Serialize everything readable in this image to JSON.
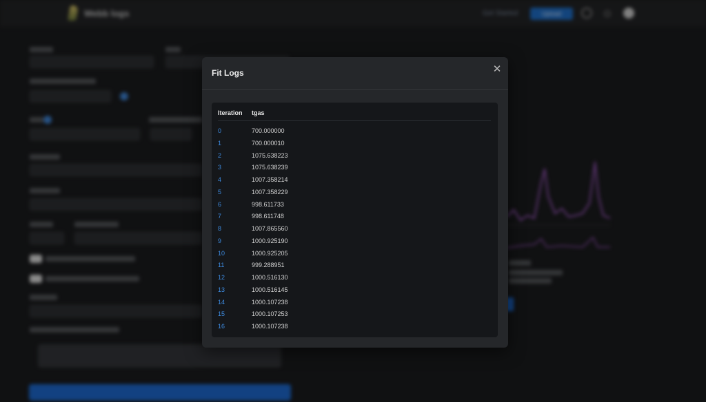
{
  "app": {
    "brand": "Webb logs",
    "nav_link": "Get Started",
    "nav_primary": "Upload"
  },
  "modal": {
    "title": "Fit Logs",
    "close_icon": "close-icon",
    "table": {
      "headers": {
        "iteration": "Iteration",
        "tgas": "tgas"
      },
      "rows": [
        {
          "iteration": "0",
          "tgas": "700.000000"
        },
        {
          "iteration": "1",
          "tgas": "700.000010"
        },
        {
          "iteration": "2",
          "tgas": "1075.638223"
        },
        {
          "iteration": "3",
          "tgas": "1075.638239"
        },
        {
          "iteration": "4",
          "tgas": "1007.358214"
        },
        {
          "iteration": "5",
          "tgas": "1007.358229"
        },
        {
          "iteration": "6",
          "tgas": "998.611733"
        },
        {
          "iteration": "7",
          "tgas": "998.611748"
        },
        {
          "iteration": "8",
          "tgas": "1007.865560"
        },
        {
          "iteration": "9",
          "tgas": "1000.925190"
        },
        {
          "iteration": "10",
          "tgas": "1000.925205"
        },
        {
          "iteration": "11",
          "tgas": "999.288951"
        },
        {
          "iteration": "12",
          "tgas": "1000.516130"
        },
        {
          "iteration": "13",
          "tgas": "1000.516145"
        },
        {
          "iteration": "14",
          "tgas": "1000.107238"
        },
        {
          "iteration": "15",
          "tgas": "1000.107253"
        },
        {
          "iteration": "16",
          "tgas": "1000.107238"
        }
      ]
    }
  },
  "colors": {
    "iteration_link": "#3d8be0",
    "primary": "#1d6ad0",
    "chart_line": "#8a4fa8"
  }
}
